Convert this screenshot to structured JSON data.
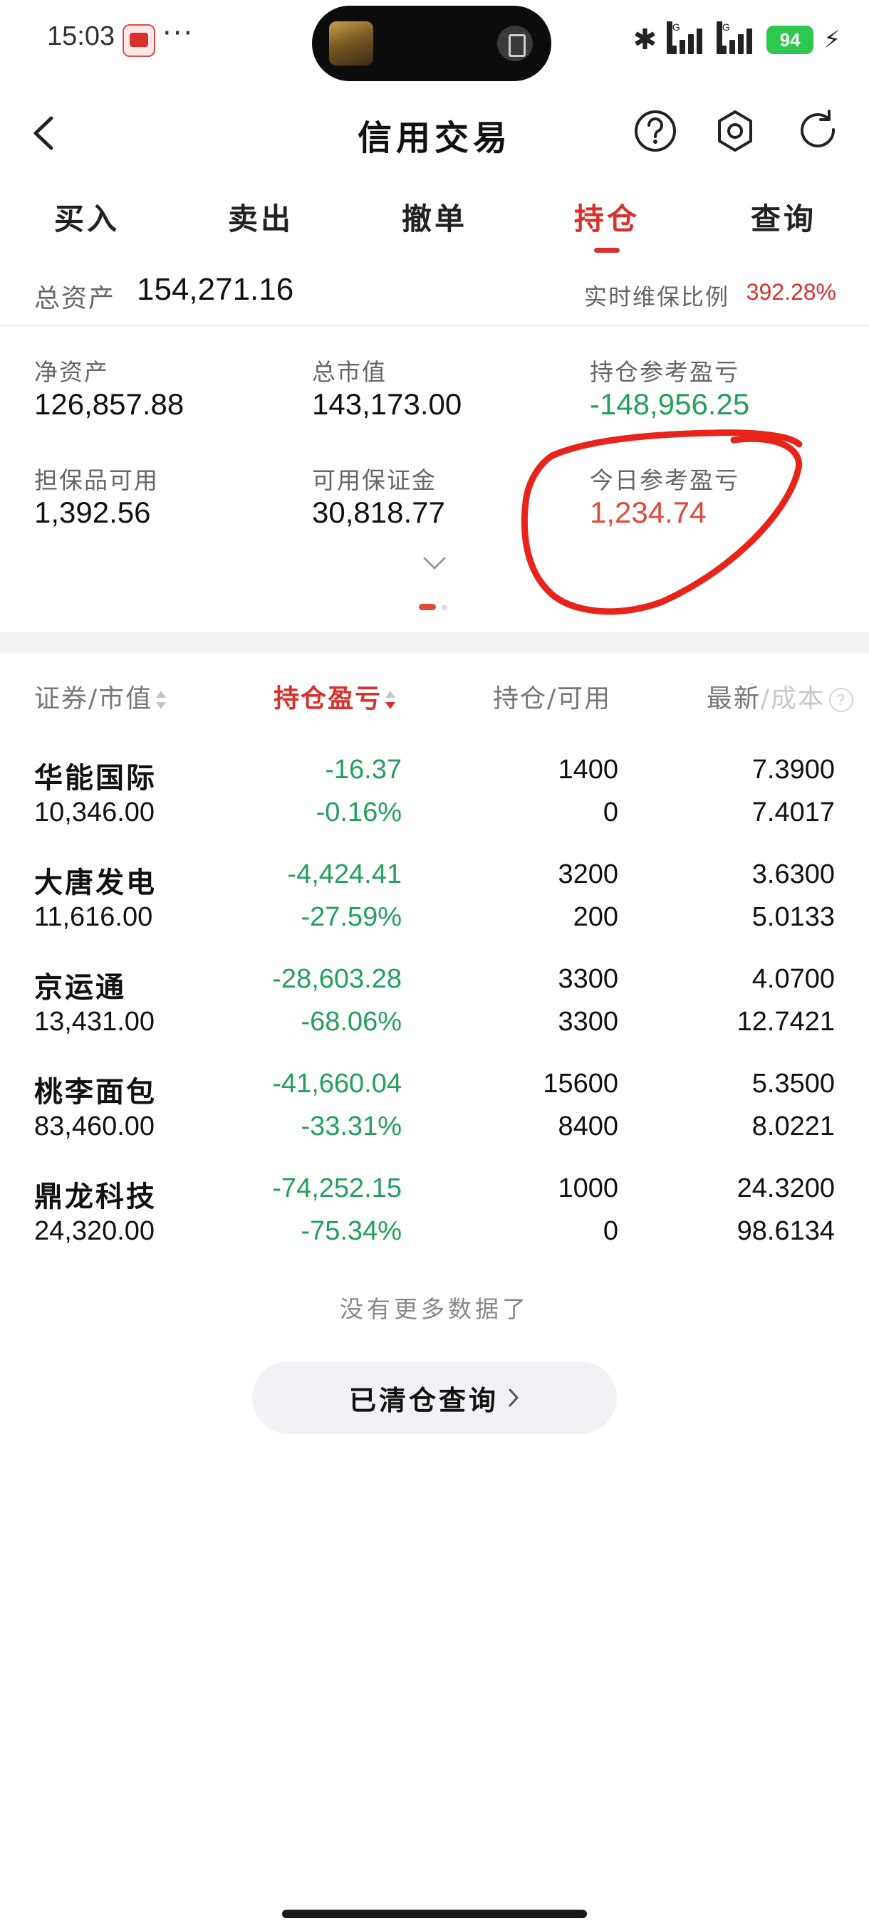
{
  "status_bar": {
    "time": "15:03",
    "more": "···",
    "net1": "4G",
    "net2": "5G",
    "battery": "94",
    "icons": [
      "app-icon",
      "calculator-icon",
      "bluetooth-icon",
      "signal-icon",
      "battery-icon",
      "charging-icon"
    ]
  },
  "header": {
    "title": "信用交易",
    "icons": [
      "back-icon",
      "help-icon",
      "gear-icon",
      "refresh-icon"
    ]
  },
  "tabs": [
    {
      "label": "买入",
      "active": false
    },
    {
      "label": "卖出",
      "active": false
    },
    {
      "label": "撤单",
      "active": false
    },
    {
      "label": "持仓",
      "active": true
    },
    {
      "label": "查询",
      "active": false
    }
  ],
  "totals": {
    "total_assets_label": "总资产",
    "total_assets_value": "154,271.16",
    "maintenance_ratio_label": "实时维保比例",
    "maintenance_ratio_value": "392.28%"
  },
  "summary": {
    "net_assets": {
      "label": "净资产",
      "value": "126,857.88"
    },
    "total_market_value": {
      "label": "总市值",
      "value": "143,173.00"
    },
    "position_pnl": {
      "label": "持仓参考盈亏",
      "value": "-148,956.25"
    },
    "collateral_available": {
      "label": "担保品可用",
      "value": "1,392.56"
    },
    "available_margin": {
      "label": "可用保证金",
      "value": "30,818.77"
    },
    "today_pnl": {
      "label": "今日参考盈亏",
      "value": "1,234.74"
    }
  },
  "colors": {
    "accent_red": "#d9302c",
    "loss_green": "#23a05a",
    "gain_red": "#e04a3a",
    "annotation_red": "#e8231a"
  },
  "table": {
    "headers": {
      "security": "证券/市值",
      "pnl": "持仓盈亏",
      "holding": "持仓/可用",
      "latest": "最新",
      "slash": "/",
      "cost": "成本"
    },
    "rows": [
      {
        "name": "华能国际",
        "market_value": "10,346.00",
        "pnl": "-16.37",
        "pnl_pct": "-0.16%",
        "holding": "1400",
        "available": "0",
        "latest": "7.3900",
        "cost": "7.4017"
      },
      {
        "name": "大唐发电",
        "market_value": "11,616.00",
        "pnl": "-4,424.41",
        "pnl_pct": "-27.59%",
        "holding": "3200",
        "available": "200",
        "latest": "3.6300",
        "cost": "5.0133"
      },
      {
        "name": "京运通",
        "market_value": "13,431.00",
        "pnl": "-28,603.28",
        "pnl_pct": "-68.06%",
        "holding": "3300",
        "available": "3300",
        "latest": "4.0700",
        "cost": "12.7421"
      },
      {
        "name": "桃李面包",
        "market_value": "83,460.00",
        "pnl": "-41,660.04",
        "pnl_pct": "-33.31%",
        "holding": "15600",
        "available": "8400",
        "latest": "5.3500",
        "cost": "8.0221"
      },
      {
        "name": "鼎龙科技",
        "market_value": "24,320.00",
        "pnl": "-74,252.15",
        "pnl_pct": "-75.34%",
        "holding": "1000",
        "available": "0",
        "latest": "24.3200",
        "cost": "98.6134"
      }
    ]
  },
  "footer": {
    "no_more": "没有更多数据了",
    "cleared_query": "已清仓查询"
  }
}
